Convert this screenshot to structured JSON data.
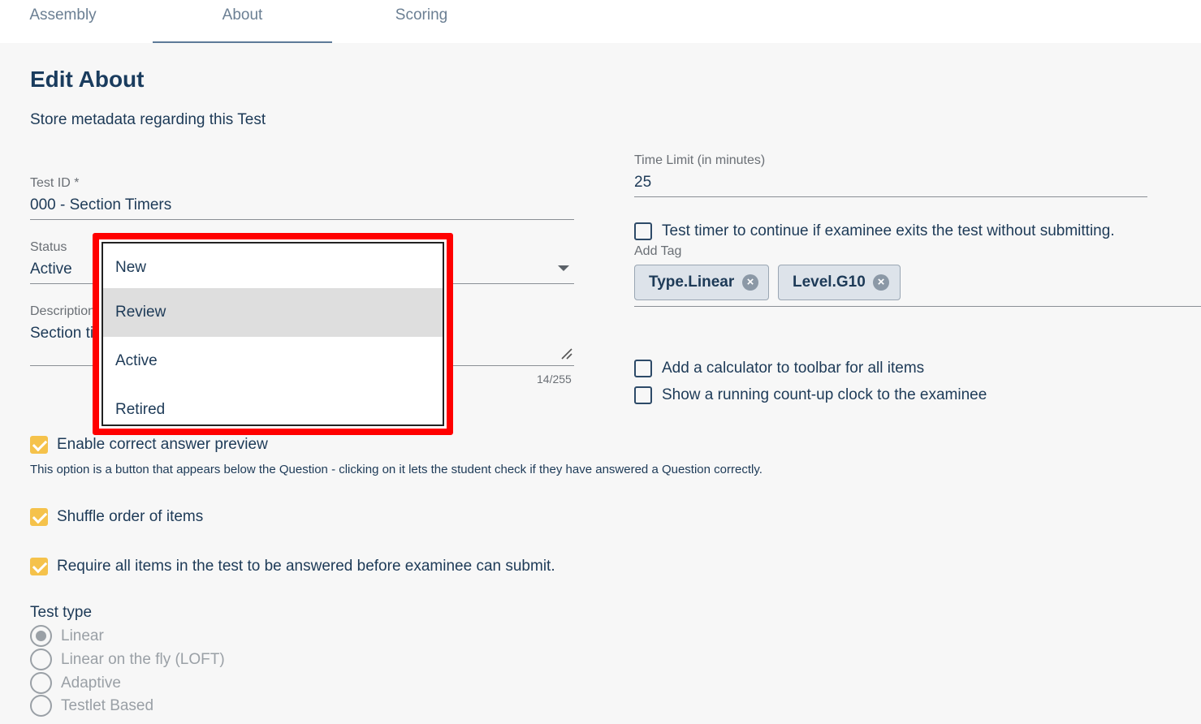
{
  "tabs": [
    {
      "label": "Assembly"
    },
    {
      "label": "About"
    },
    {
      "label": "Scoring"
    }
  ],
  "page": {
    "title": "Edit About",
    "subtitle": "Store metadata regarding this Test"
  },
  "test_id": {
    "label": "Test ID *",
    "value": "000 - Section Timers"
  },
  "status": {
    "label": "Status",
    "value": "Active",
    "options": [
      "New",
      "Review",
      "Active",
      "Retired"
    ],
    "highlighted": "Review"
  },
  "description": {
    "label": "Description",
    "value_visible": "Section ti",
    "counter": "14/255"
  },
  "time_limit": {
    "label": "Time Limit (in minutes)",
    "value": "25"
  },
  "timer_continue": {
    "label": "Test timer to continue if examinee exits the test without submitting.",
    "checked": false
  },
  "tags": {
    "label": "Add Tag",
    "items": [
      "Type.Linear",
      "Level.G10"
    ]
  },
  "calculator": {
    "label": "Add a calculator to toolbar for all items",
    "checked": false
  },
  "countup_clock": {
    "label": "Show a running count-up clock to the examinee",
    "checked": false
  },
  "answer_preview": {
    "label": "Enable correct answer preview",
    "checked": true,
    "help": "This option is a button that appears below the Question - clicking on it lets the student check if they have answered a Question correctly."
  },
  "shuffle": {
    "label": "Shuffle order of items",
    "checked": true
  },
  "require_all": {
    "label": "Require all items in the test to be answered before examinee can submit.",
    "checked": true
  },
  "test_type": {
    "label": "Test type",
    "options": [
      "Linear",
      "Linear on the fly (LOFT)",
      "Adaptive",
      "Testlet Based"
    ],
    "selected": "Linear"
  },
  "colors": {
    "accent_check": "#f5c24b",
    "highlight_border": "#ff0000",
    "text": "#1d3a57"
  },
  "icons": {
    "tag_remove": "close-circle-icon",
    "select_caret": "caret-down-icon",
    "textarea_resize": "resize-handle-icon"
  }
}
